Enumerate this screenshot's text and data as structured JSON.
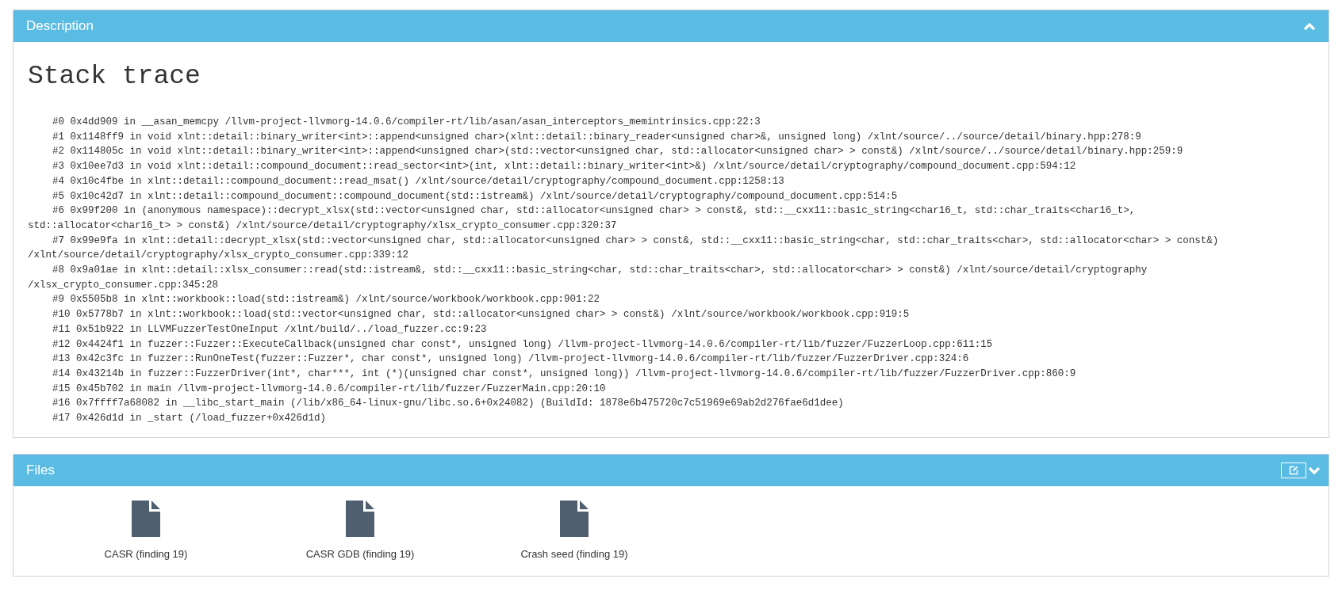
{
  "description": {
    "title": "Description",
    "expanded": true,
    "heading": "Stack trace",
    "frames": [
      {
        "text": "#0 0x4dd909 in __asan_memcpy /llvm-project-llvmorg-14.0.6/compiler-rt/lib/asan/asan_interceptors_memintrinsics.cpp:22:3"
      },
      {
        "text": "#1 0x1148ff9 in void xlnt::detail::binary_writer<int>::append<unsigned char>(xlnt::detail::binary_reader<unsigned char>&, unsigned long) /xlnt/source/../source/detail/binary.hpp:278:9"
      },
      {
        "text": "#2 0x114805c in void xlnt::detail::binary_writer<int>::append<unsigned char>(std::vector<unsigned char, std::allocator<unsigned char> > const&) /xlnt/source/../source/detail/binary.hpp:259:9"
      },
      {
        "text": "#3 0x10ee7d3 in void xlnt::detail::compound_document::read_sector<int>(int, xlnt::detail::binary_writer<int>&) /xlnt/source/detail/cryptography/compound_document.cpp:594:12"
      },
      {
        "text": "#4 0x10c4fbe in xlnt::detail::compound_document::read_msat() /xlnt/source/detail/cryptography/compound_document.cpp:1258:13"
      },
      {
        "text": "#5 0x10c42d7 in xlnt::detail::compound_document::compound_document(std::istream&) /xlnt/source/detail/cryptography/compound_document.cpp:514:5"
      },
      {
        "text": "#6 0x99f200 in (anonymous namespace)::decrypt_xlsx(std::vector<unsigned char, std::allocator<unsigned char> > const&, std::__cxx11::basic_string<char16_t, std::char_traits<char16_t>,",
        "continuation": "std::allocator<char16_t> > const&) /xlnt/source/detail/cryptography/xlsx_crypto_consumer.cpp:320:37"
      },
      {
        "text": "#7 0x99e9fa in xlnt::detail::decrypt_xlsx(std::vector<unsigned char, std::allocator<unsigned char> > const&, std::__cxx11::basic_string<char, std::char_traits<char>, std::allocator<char> > const&)",
        "continuation": "/xlnt/source/detail/cryptography/xlsx_crypto_consumer.cpp:339:12"
      },
      {
        "text": "#8 0x9a01ae in xlnt::detail::xlsx_consumer::read(std::istream&, std::__cxx11::basic_string<char, std::char_traits<char>, std::allocator<char> > const&) /xlnt/source/detail/cryptography",
        "continuation": "/xlsx_crypto_consumer.cpp:345:28"
      },
      {
        "text": "#9 0x5505b8 in xlnt::workbook::load(std::istream&) /xlnt/source/workbook/workbook.cpp:901:22"
      },
      {
        "text": "#10 0x5778b7 in xlnt::workbook::load(std::vector<unsigned char, std::allocator<unsigned char> > const&) /xlnt/source/workbook/workbook.cpp:919:5"
      },
      {
        "text": "#11 0x51b922 in LLVMFuzzerTestOneInput /xlnt/build/../load_fuzzer.cc:9:23"
      },
      {
        "text": "#12 0x4424f1 in fuzzer::Fuzzer::ExecuteCallback(unsigned char const*, unsigned long) /llvm-project-llvmorg-14.0.6/compiler-rt/lib/fuzzer/FuzzerLoop.cpp:611:15"
      },
      {
        "text": "#13 0x42c3fc in fuzzer::RunOneTest(fuzzer::Fuzzer*, char const*, unsigned long) /llvm-project-llvmorg-14.0.6/compiler-rt/lib/fuzzer/FuzzerDriver.cpp:324:6"
      },
      {
        "text": "#14 0x43214b in fuzzer::FuzzerDriver(int*, char***, int (*)(unsigned char const*, unsigned long)) /llvm-project-llvmorg-14.0.6/compiler-rt/lib/fuzzer/FuzzerDriver.cpp:860:9"
      },
      {
        "text": "#15 0x45b702 in main /llvm-project-llvmorg-14.0.6/compiler-rt/lib/fuzzer/FuzzerMain.cpp:20:10"
      },
      {
        "text": "#16 0x7ffff7a68082 in __libc_start_main (/lib/x86_64-linux-gnu/libc.so.6+0x24082) (BuildId: 1878e6b475720c7c51969e69ab2d276fae6d1dee)"
      },
      {
        "text": "#17 0x426d1d in _start (/load_fuzzer+0x426d1d)"
      }
    ]
  },
  "files": {
    "title": "Files",
    "expanded": false,
    "items": [
      {
        "name": "CASR (finding 19)"
      },
      {
        "name": "CASR GDB (finding 19)"
      },
      {
        "name": "Crash seed (finding 19)"
      }
    ]
  }
}
